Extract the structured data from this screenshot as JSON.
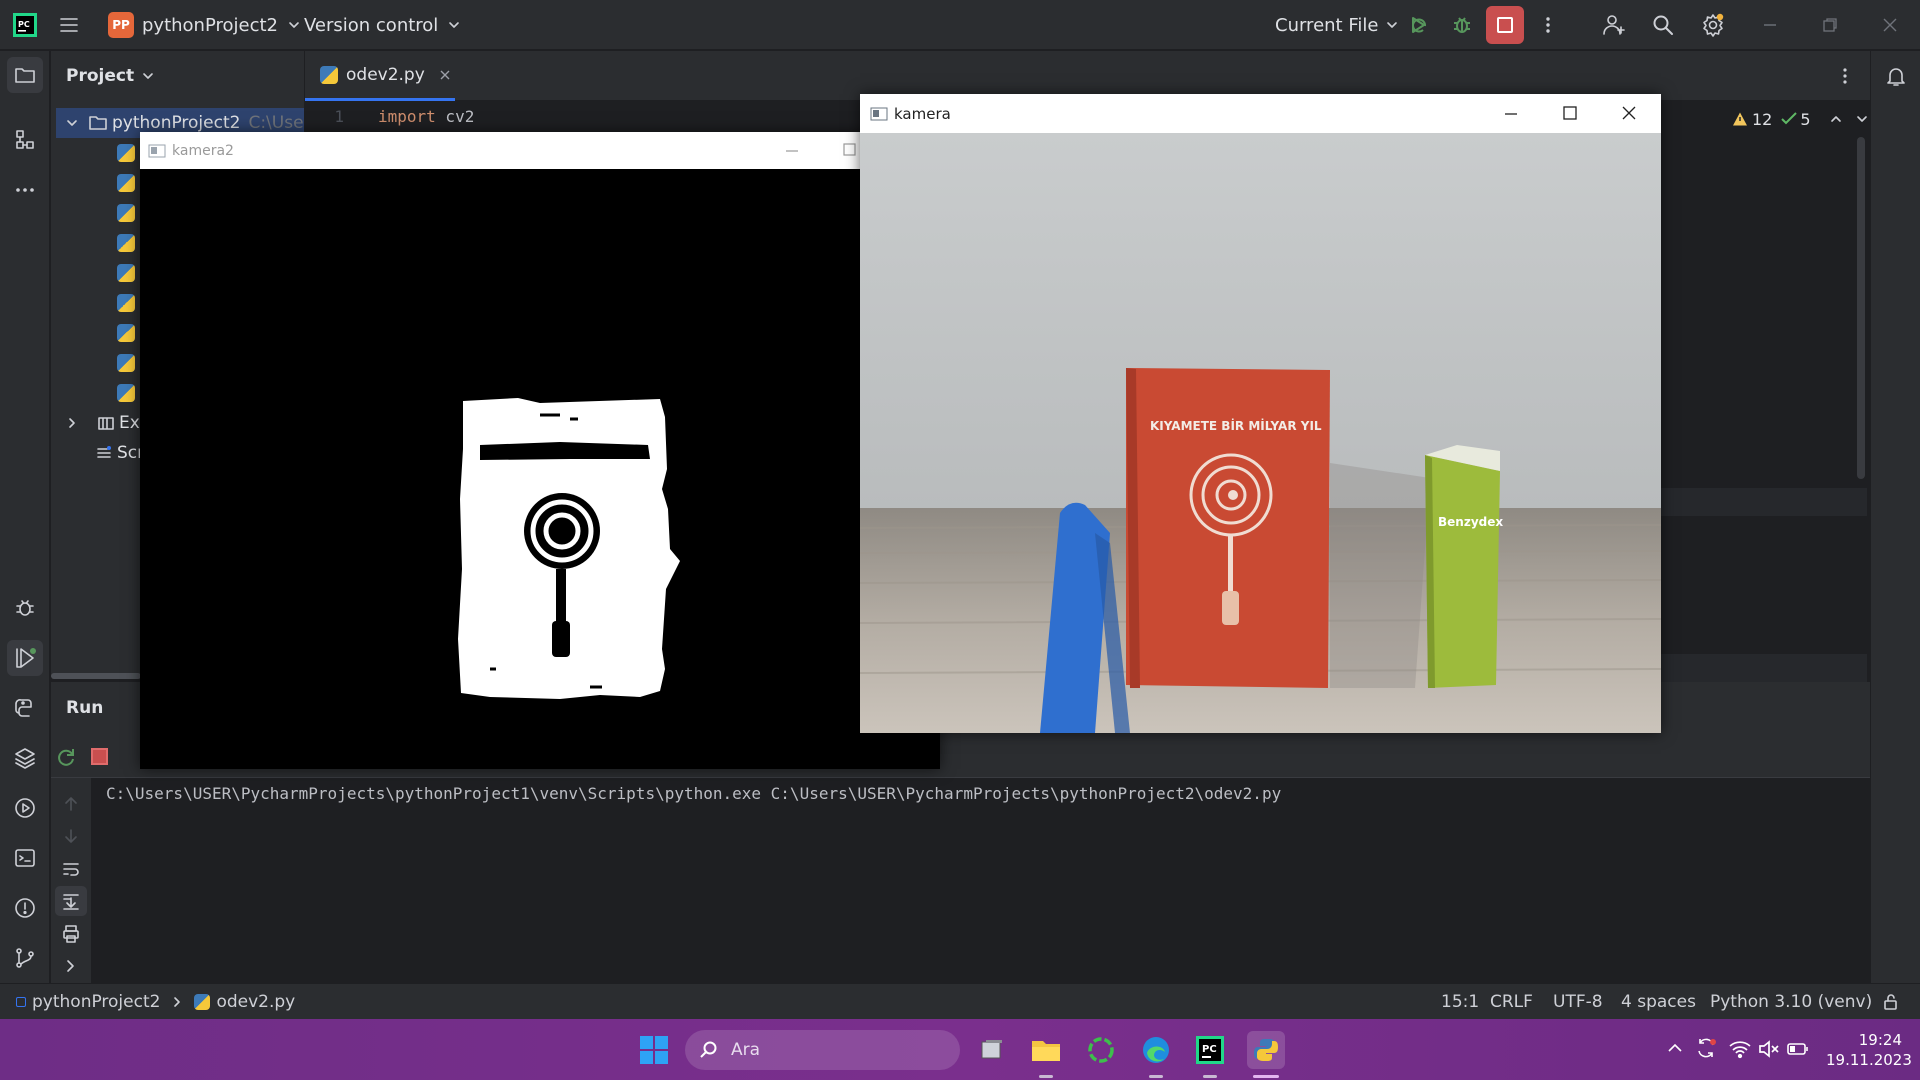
{
  "titlebar": {
    "project_badge": "PP",
    "project_name": "pythonProject2",
    "version_control": "Version control",
    "run_config": "Current File"
  },
  "project_panel": {
    "title": "Project",
    "root_name": "pythonProject2",
    "root_path": "C:\\Use",
    "external_libs": "Ext",
    "scratches": "Scr"
  },
  "editor": {
    "tab_name": "odev2.py",
    "line_number": "1",
    "code_keyword": "import",
    "code_rest": " cv2",
    "warnings": "12",
    "checks": "5"
  },
  "run_panel": {
    "title": "Run",
    "output": "C:\\Users\\USER\\PycharmProjects\\pythonProject1\\venv\\Scripts\\python.exe C:\\Users\\USER\\PycharmProjects\\pythonProject2\\odev2.py"
  },
  "statusbar": {
    "crumb_project": "pythonProject2",
    "crumb_file": "odev2.py",
    "position": "15:1",
    "line_sep": "CRLF",
    "encoding": "UTF-8",
    "indent": "4 spaces",
    "interpreter": "Python 3.10 (venv)"
  },
  "windows": {
    "kamera2_title": "kamera2",
    "kamera_title": "kamera"
  },
  "book": {
    "title": "KIYAMETE BİR MİLYAR YIL",
    "box_label": "Benzydex"
  },
  "taskbar": {
    "search_placeholder": "Ara",
    "time": "19:24",
    "date": "19.11.2023"
  }
}
